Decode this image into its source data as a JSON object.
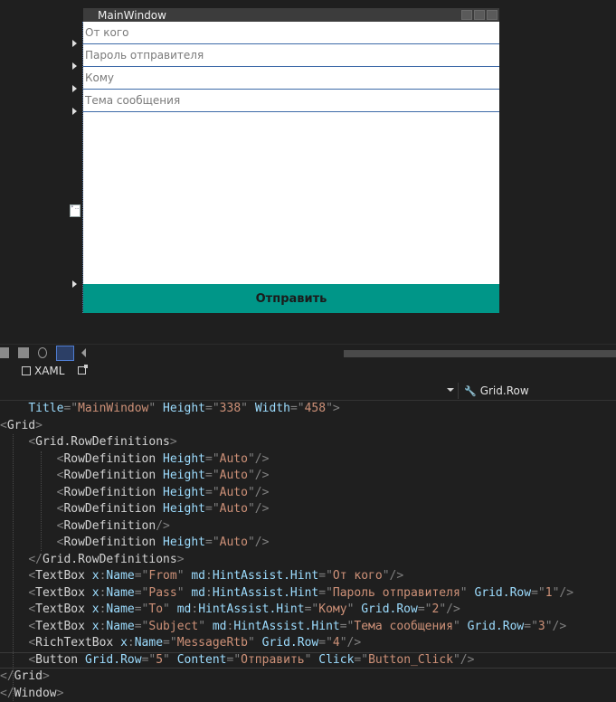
{
  "designer": {
    "window_title": "MainWindow",
    "fields": [
      {
        "hint": "От кого"
      },
      {
        "hint": "Пароль отправителя"
      },
      {
        "hint": "Кому"
      },
      {
        "hint": "Тема сообщения"
      }
    ],
    "button_label": "Отправить",
    "button_color": "#009688"
  },
  "tabs": {
    "xaml_label": "XAML"
  },
  "nav": {
    "selected": "Grid.Row"
  },
  "code": {
    "lines": [
      {
        "indent": "    ",
        "tokens": [
          [
            "a",
            "Title"
          ],
          [
            "b",
            "=\""
          ],
          [
            "v",
            "MainWindow"
          ],
          [
            "b",
            "\" "
          ],
          [
            "a",
            "Height"
          ],
          [
            "b",
            "=\""
          ],
          [
            "v",
            "338"
          ],
          [
            "b",
            "\" "
          ],
          [
            "a",
            "Width"
          ],
          [
            "b",
            "=\""
          ],
          [
            "v",
            "458"
          ],
          [
            "b",
            "\">"
          ]
        ]
      },
      {
        "indent": "",
        "tokens": [
          [
            "b",
            "<"
          ],
          [
            "tg",
            "Grid"
          ],
          [
            "b",
            ">"
          ]
        ]
      },
      {
        "indent": "    ",
        "tokens": [
          [
            "b",
            "<"
          ],
          [
            "tg",
            "Grid.RowDefinitions"
          ],
          [
            "b",
            ">"
          ]
        ]
      },
      {
        "indent": "        ",
        "tokens": [
          [
            "b",
            "<"
          ],
          [
            "tg",
            "RowDefinition "
          ],
          [
            "a",
            "Height"
          ],
          [
            "b",
            "=\""
          ],
          [
            "v",
            "Auto"
          ],
          [
            "b",
            "\"/>"
          ]
        ]
      },
      {
        "indent": "        ",
        "tokens": [
          [
            "b",
            "<"
          ],
          [
            "tg",
            "RowDefinition "
          ],
          [
            "a",
            "Height"
          ],
          [
            "b",
            "=\""
          ],
          [
            "v",
            "Auto"
          ],
          [
            "b",
            "\"/>"
          ]
        ]
      },
      {
        "indent": "        ",
        "tokens": [
          [
            "b",
            "<"
          ],
          [
            "tg",
            "RowDefinition "
          ],
          [
            "a",
            "Height"
          ],
          [
            "b",
            "=\""
          ],
          [
            "v",
            "Auto"
          ],
          [
            "b",
            "\"/>"
          ]
        ]
      },
      {
        "indent": "        ",
        "tokens": [
          [
            "b",
            "<"
          ],
          [
            "tg",
            "RowDefinition "
          ],
          [
            "a",
            "Height"
          ],
          [
            "b",
            "=\""
          ],
          [
            "v",
            "Auto"
          ],
          [
            "b",
            "\"/>"
          ]
        ]
      },
      {
        "indent": "        ",
        "tokens": [
          [
            "b",
            "<"
          ],
          [
            "tg",
            "RowDefinition"
          ],
          [
            "b",
            "/>"
          ]
        ]
      },
      {
        "indent": "        ",
        "tokens": [
          [
            "b",
            "<"
          ],
          [
            "tg",
            "RowDefinition "
          ],
          [
            "a",
            "Height"
          ],
          [
            "b",
            "=\""
          ],
          [
            "v",
            "Auto"
          ],
          [
            "b",
            "\"/>"
          ]
        ]
      },
      {
        "indent": "    ",
        "tokens": [
          [
            "b",
            "</"
          ],
          [
            "tg",
            "Grid.RowDefinitions"
          ],
          [
            "b",
            ">"
          ]
        ]
      },
      {
        "indent": "    ",
        "tokens": [
          [
            "b",
            "<"
          ],
          [
            "tg",
            "TextBox "
          ],
          [
            "a",
            "x"
          ],
          [
            "b",
            ":"
          ],
          [
            "a",
            "Name"
          ],
          [
            "b",
            "=\""
          ],
          [
            "v",
            "From"
          ],
          [
            "b",
            "\" "
          ],
          [
            "a",
            "md"
          ],
          [
            "b",
            ":"
          ],
          [
            "a",
            "HintAssist.Hint"
          ],
          [
            "b",
            "=\""
          ],
          [
            "v",
            "От кого"
          ],
          [
            "b",
            "\"/>"
          ]
        ]
      },
      {
        "indent": "    ",
        "tokens": [
          [
            "b",
            "<"
          ],
          [
            "tg",
            "TextBox "
          ],
          [
            "a",
            "x"
          ],
          [
            "b",
            ":"
          ],
          [
            "a",
            "Name"
          ],
          [
            "b",
            "=\""
          ],
          [
            "v",
            "Pass"
          ],
          [
            "b",
            "\" "
          ],
          [
            "a",
            "md"
          ],
          [
            "b",
            ":"
          ],
          [
            "a",
            "HintAssist.Hint"
          ],
          [
            "b",
            "=\""
          ],
          [
            "v",
            "Пароль отправителя"
          ],
          [
            "b",
            "\" "
          ],
          [
            "a",
            "Grid.Row"
          ],
          [
            "b",
            "=\""
          ],
          [
            "v",
            "1"
          ],
          [
            "b",
            "\"/>"
          ]
        ]
      },
      {
        "indent": "    ",
        "tokens": [
          [
            "b",
            "<"
          ],
          [
            "tg",
            "TextBox "
          ],
          [
            "a",
            "x"
          ],
          [
            "b",
            ":"
          ],
          [
            "a",
            "Name"
          ],
          [
            "b",
            "=\""
          ],
          [
            "v",
            "To"
          ],
          [
            "b",
            "\" "
          ],
          [
            "a",
            "md"
          ],
          [
            "b",
            ":"
          ],
          [
            "a",
            "HintAssist.Hint"
          ],
          [
            "b",
            "=\""
          ],
          [
            "v",
            "Кому"
          ],
          [
            "b",
            "\" "
          ],
          [
            "a",
            "Grid.Row"
          ],
          [
            "b",
            "=\""
          ],
          [
            "v",
            "2"
          ],
          [
            "b",
            "\"/>"
          ]
        ]
      },
      {
        "indent": "    ",
        "tokens": [
          [
            "b",
            "<"
          ],
          [
            "tg",
            "TextBox "
          ],
          [
            "a",
            "x"
          ],
          [
            "b",
            ":"
          ],
          [
            "a",
            "Name"
          ],
          [
            "b",
            "=\""
          ],
          [
            "v",
            "Subject"
          ],
          [
            "b",
            "\" "
          ],
          [
            "a",
            "md"
          ],
          [
            "b",
            ":"
          ],
          [
            "a",
            "HintAssist.Hint"
          ],
          [
            "b",
            "=\""
          ],
          [
            "v",
            "Тема сообщения"
          ],
          [
            "b",
            "\" "
          ],
          [
            "a",
            "Grid.Row"
          ],
          [
            "b",
            "=\""
          ],
          [
            "v",
            "3"
          ],
          [
            "b",
            "\"/>"
          ]
        ]
      },
      {
        "indent": "    ",
        "tokens": [
          [
            "b",
            "<"
          ],
          [
            "tg",
            "RichTextBox "
          ],
          [
            "a",
            "x"
          ],
          [
            "b",
            ":"
          ],
          [
            "a",
            "Name"
          ],
          [
            "b",
            "=\""
          ],
          [
            "v",
            "MessageRtb"
          ],
          [
            "b",
            "\" "
          ],
          [
            "a",
            "Grid.Row"
          ],
          [
            "b",
            "=\""
          ],
          [
            "v",
            "4"
          ],
          [
            "b",
            "\"/>"
          ]
        ]
      },
      {
        "indent": "    ",
        "tokens": [
          [
            "b",
            "<"
          ],
          [
            "tg",
            "Button "
          ],
          [
            "a",
            "Grid.Row"
          ],
          [
            "b",
            "=\""
          ],
          [
            "v",
            "5"
          ],
          [
            "b",
            "\" "
          ],
          [
            "a",
            "Content"
          ],
          [
            "b",
            "=\""
          ],
          [
            "v",
            "Отправить"
          ],
          [
            "b",
            "\" "
          ],
          [
            "a",
            "Click"
          ],
          [
            "b",
            "=\""
          ],
          [
            "v",
            "Button_Click"
          ],
          [
            "b",
            "\"/>"
          ]
        ]
      },
      {
        "indent": "",
        "tokens": [
          [
            "b",
            "</"
          ],
          [
            "tg",
            "Grid"
          ],
          [
            "b",
            ">"
          ]
        ]
      },
      {
        "indent": "",
        "tokens": [
          [
            "b",
            "</"
          ],
          [
            "tg",
            "Window"
          ],
          [
            "b",
            ">"
          ]
        ]
      }
    ]
  }
}
